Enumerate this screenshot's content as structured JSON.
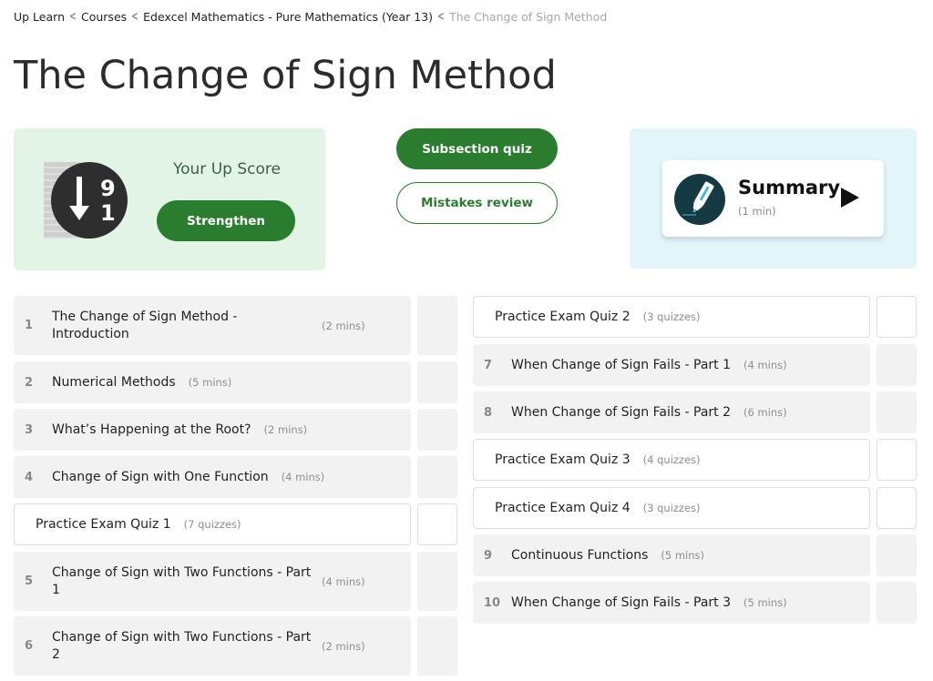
{
  "breadcrumb": {
    "items": [
      "Up Learn",
      "Courses",
      "Edexcel Mathematics - Pure Mathematics (Year 13)",
      "The Change of Sign Method"
    ],
    "separator_icon": "chevron-left-icon"
  },
  "page": {
    "title": "The Change of Sign Method"
  },
  "upscore": {
    "label": "Your Up Score",
    "icon": "sort-descending-9-1-icon",
    "icon_digits": [
      "9",
      "1"
    ],
    "strengthen_label": "Strengthen"
  },
  "actions": {
    "subsection_quiz_label": "Subsection quiz",
    "mistakes_review_label": "Mistakes review"
  },
  "summary": {
    "title": "Summary",
    "duration": "(1 min)",
    "icon": "highlighter-pen-icon",
    "play_icon": "play-icon"
  },
  "colors": {
    "primary_green": "#2a7d2e",
    "upscore_bg": "#e2f4e5",
    "summary_bg": "#e2f6f9",
    "lesson_bg": "#f2f2f2"
  },
  "left_column": [
    {
      "type": "lesson",
      "number": "1",
      "title": "The Change of Sign Method - Introduction",
      "duration": "(2 mins)"
    },
    {
      "type": "lesson",
      "number": "2",
      "title": "Numerical Methods",
      "duration": "(5 mins)"
    },
    {
      "type": "lesson",
      "number": "3",
      "title": "What’s Happening at the Root?",
      "duration": "(2 mins)"
    },
    {
      "type": "lesson",
      "number": "4",
      "title": "Change of Sign with One Function",
      "duration": "(4 mins)"
    },
    {
      "type": "quiz",
      "title": "Practice Exam Quiz 1",
      "duration": "(7 quizzes)"
    },
    {
      "type": "lesson",
      "number": "5",
      "title": "Change of Sign with Two Functions - Part 1",
      "duration": "(4 mins)"
    },
    {
      "type": "lesson",
      "number": "6",
      "title": "Change of Sign with Two Functions - Part 2",
      "duration": "(2 mins)"
    }
  ],
  "right_column": [
    {
      "type": "quiz",
      "title": "Practice Exam Quiz 2",
      "duration": "(3 quizzes)"
    },
    {
      "type": "lesson",
      "number": "7",
      "title": "When Change of Sign Fails - Part 1",
      "duration": "(4 mins)"
    },
    {
      "type": "lesson",
      "number": "8",
      "title": "When Change of Sign Fails - Part 2",
      "duration": "(6 mins)"
    },
    {
      "type": "quiz",
      "title": "Practice Exam Quiz 3",
      "duration": "(4 quizzes)"
    },
    {
      "type": "quiz",
      "title": "Practice Exam Quiz 4",
      "duration": "(3 quizzes)"
    },
    {
      "type": "lesson",
      "number": "9",
      "title": "Continuous Functions",
      "duration": "(5 mins)"
    },
    {
      "type": "lesson",
      "number": "10",
      "title": "When Change of Sign Fails - Part 3",
      "duration": "(5 mins)"
    }
  ]
}
